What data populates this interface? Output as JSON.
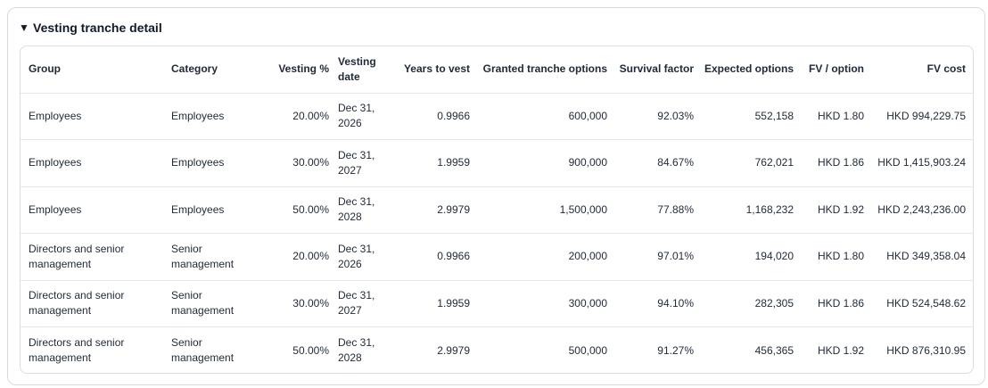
{
  "section": {
    "title": "Vesting tranche detail"
  },
  "table": {
    "headers": {
      "group": "Group",
      "category": "Category",
      "vesting_pct": "Vesting %",
      "vesting_date": "Vesting date",
      "years_to_vest": "Years to vest",
      "granted": "Granted tranche options",
      "survival": "Survival factor",
      "expected": "Expected options",
      "fv_option": "FV / option",
      "fv_cost": "FV cost"
    },
    "rows": [
      {
        "group": "Employees",
        "category": "Employees",
        "vesting_pct": "20.00%",
        "vesting_date": "Dec 31, 2026",
        "years_to_vest": "0.9966",
        "granted": "600,000",
        "survival": "92.03%",
        "expected": "552,158",
        "fv_option": "HKD 1.80",
        "fv_cost": "HKD 994,229.75"
      },
      {
        "group": "Employees",
        "category": "Employees",
        "vesting_pct": "30.00%",
        "vesting_date": "Dec 31, 2027",
        "years_to_vest": "1.9959",
        "granted": "900,000",
        "survival": "84.67%",
        "expected": "762,021",
        "fv_option": "HKD 1.86",
        "fv_cost": "HKD 1,415,903.24"
      },
      {
        "group": "Employees",
        "category": "Employees",
        "vesting_pct": "50.00%",
        "vesting_date": "Dec 31, 2028",
        "years_to_vest": "2.9979",
        "granted": "1,500,000",
        "survival": "77.88%",
        "expected": "1,168,232",
        "fv_option": "HKD 1.92",
        "fv_cost": "HKD 2,243,236.00"
      },
      {
        "group": "Directors and senior management",
        "category": "Senior management",
        "vesting_pct": "20.00%",
        "vesting_date": "Dec 31, 2026",
        "years_to_vest": "0.9966",
        "granted": "200,000",
        "survival": "97.01%",
        "expected": "194,020",
        "fv_option": "HKD 1.80",
        "fv_cost": "HKD 349,358.04"
      },
      {
        "group": "Directors and senior management",
        "category": "Senior management",
        "vesting_pct": "30.00%",
        "vesting_date": "Dec 31, 2027",
        "years_to_vest": "1.9959",
        "granted": "300,000",
        "survival": "94.10%",
        "expected": "282,305",
        "fv_option": "HKD 1.86",
        "fv_cost": "HKD 524,548.62"
      },
      {
        "group": "Directors and senior management",
        "category": "Senior management",
        "vesting_pct": "50.00%",
        "vesting_date": "Dec 31, 2028",
        "years_to_vest": "2.9979",
        "granted": "500,000",
        "survival": "91.27%",
        "expected": "456,365",
        "fv_option": "HKD 1.92",
        "fv_cost": "HKD 876,310.95"
      }
    ]
  }
}
